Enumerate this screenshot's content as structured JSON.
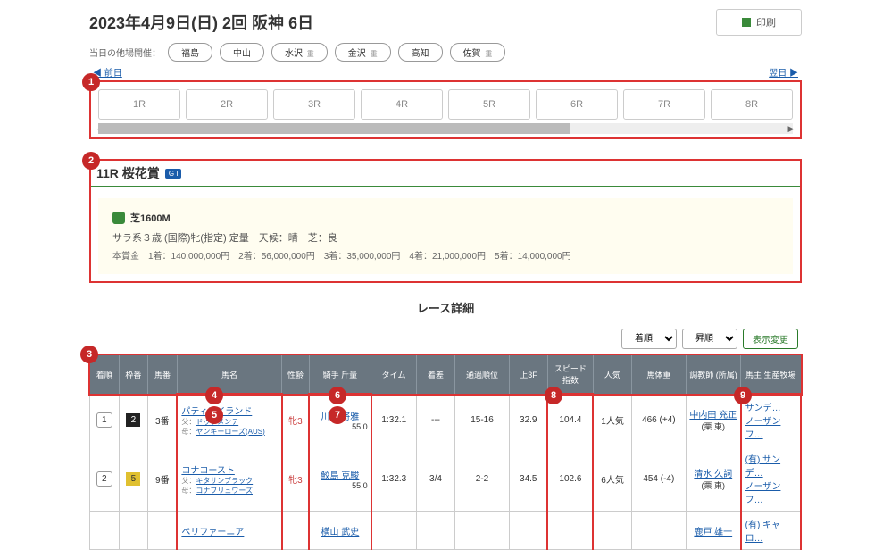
{
  "header": {
    "title": "2023年4月9日(日) 2回 阪神 6日",
    "print_label": "印刷"
  },
  "venues": {
    "label": "当日の他場開催：",
    "items": [
      {
        "name": "福島",
        "badge": ""
      },
      {
        "name": "中山",
        "badge": ""
      },
      {
        "name": "水沢",
        "badge": "重"
      },
      {
        "name": "金沢",
        "badge": "重"
      },
      {
        "name": "高知",
        "badge": ""
      },
      {
        "name": "佐賀",
        "badge": "重"
      }
    ]
  },
  "nav": {
    "prev": "◀ 前日",
    "next": "翌日 ▶"
  },
  "race_tabs": [
    "1R",
    "2R",
    "3R",
    "4R",
    "5R",
    "6R",
    "7R",
    "8R"
  ],
  "race_info": {
    "heading": "11R 桜花賞",
    "grade": "G I",
    "course": "芝1600M",
    "cond_line": "サラ系３歳 (国際)牝(指定) 定量　天候：晴　芝：良",
    "prize_label": "本賞金",
    "prizes": "1着：140,000,000円　2着：56,000,000円　3着：35,000,000円　4着：21,000,000円　5着：14,000,000円"
  },
  "detail_heading": "レース詳細",
  "controls": {
    "sort1": "着順",
    "sort2": "昇順",
    "apply": "表示変更"
  },
  "columns": [
    "着順",
    "枠番",
    "馬番",
    "馬名",
    "性齢",
    "騎手\n斤量",
    "タイム",
    "着差",
    "通過順位",
    "上3F",
    "スピード\n指数",
    "人気",
    "馬体重",
    "調教師\n(所属)",
    "馬主\n生産牧場"
  ],
  "rows": [
    {
      "finish": "1",
      "frame": "2",
      "frame_cls": "f2",
      "num": "3番",
      "horse": "パティアイランド",
      "sire": "ドゥラメンテ",
      "dam": "ヤンキーローズ(AUS)",
      "sex": "牝3",
      "jockey": "川田 将雅",
      "weight": "55.0",
      "time": "1:32.1",
      "margin": "---",
      "pass": "15-16",
      "f3": "32.9",
      "speed": "104.4",
      "pop": "1人気",
      "hw": "466 (+4)",
      "trainer": "中内田 充正",
      "stable": "(栗 東)",
      "owner": "サンデ…",
      "farm": "ノーザンフ…"
    },
    {
      "finish": "2",
      "frame": "5",
      "frame_cls": "f5",
      "num": "9番",
      "horse": "コナコースト",
      "sire": "キタサンブラック",
      "dam": "コナブリュワーズ",
      "sex": "牝3",
      "jockey": "鮫島 克駿",
      "weight": "55.0",
      "time": "1:32.3",
      "margin": "3/4",
      "pass": "2-2",
      "f3": "34.5",
      "speed": "102.6",
      "pop": "6人気",
      "hw": "454 (-4)",
      "trainer": "清水 久詞",
      "stable": "(栗 東)",
      "owner": "(有) サンデ…",
      "farm": "ノーザンフ…"
    },
    {
      "finish": "",
      "frame": "",
      "frame_cls": "f0",
      "num": "",
      "horse": "ペリファーニア",
      "sire": "",
      "dam": "",
      "sex": "",
      "jockey": "横山 武史",
      "weight": "",
      "time": "",
      "margin": "",
      "pass": "",
      "f3": "",
      "speed": "",
      "pop": "",
      "hw": "",
      "trainer": "鹿戸 雄一",
      "stable": "",
      "owner": "(有) キャロ…",
      "farm": ""
    }
  ],
  "markers": [
    "1",
    "2",
    "3",
    "4",
    "5",
    "6",
    "7",
    "8",
    "9"
  ]
}
